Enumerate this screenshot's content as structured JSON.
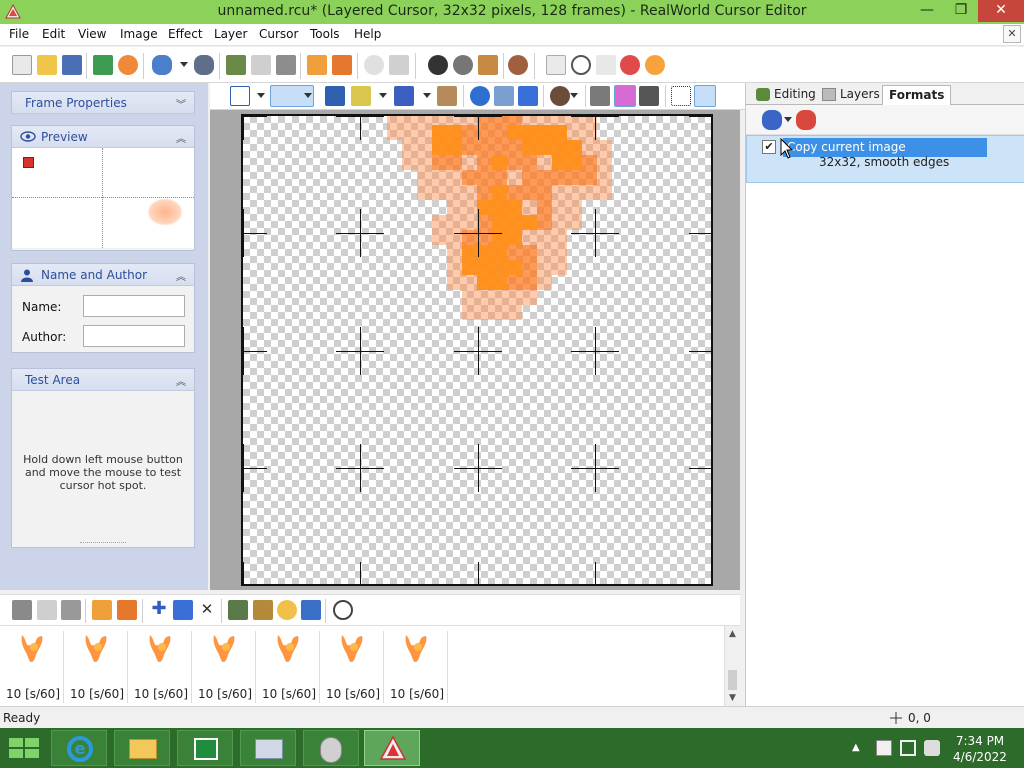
{
  "window": {
    "title": "unnamed.rcu* (Layered Cursor, 32x32 pixels, 128 frames) - RealWorld Cursor Editor"
  },
  "menu": [
    "File",
    "Edit",
    "View",
    "Image",
    "Effect",
    "Layer",
    "Cursor",
    "Tools",
    "Help"
  ],
  "left_panels": {
    "frame_properties": "Frame Properties",
    "preview": "Preview",
    "name_author": "Name and Author",
    "name_label": "Name:",
    "author_label": "Author:",
    "name_value": "",
    "author_value": "",
    "test_area": "Test Area",
    "test_hint": "Hold down left mouse button and move the mouse to test cursor hot spot."
  },
  "right_panel": {
    "tabs": [
      "Editing",
      "Layers",
      "Formats"
    ],
    "active_tab": "Formats",
    "format_item": {
      "checked": true,
      "title": "Copy current image",
      "subtitle": "32x32, smooth edges"
    }
  },
  "frames": [
    {
      "label": "10 [s/60]"
    },
    {
      "label": "10 [s/60]"
    },
    {
      "label": "10 [s/60]"
    },
    {
      "label": "10 [s/60]"
    },
    {
      "label": "10 [s/60]"
    },
    {
      "label": "10 [s/60]"
    },
    {
      "label": "10 [s/60]"
    }
  ],
  "status": {
    "text": "Ready",
    "coords": "0, 0"
  },
  "taskbar": {
    "time": "7:34 PM",
    "date": "4/6/2022"
  },
  "colors": {
    "accent_green": "#8cd25a",
    "taskbar": "#2c6b2a",
    "fire_orange": "#ff8a2a",
    "selection": "#3c91e6"
  }
}
